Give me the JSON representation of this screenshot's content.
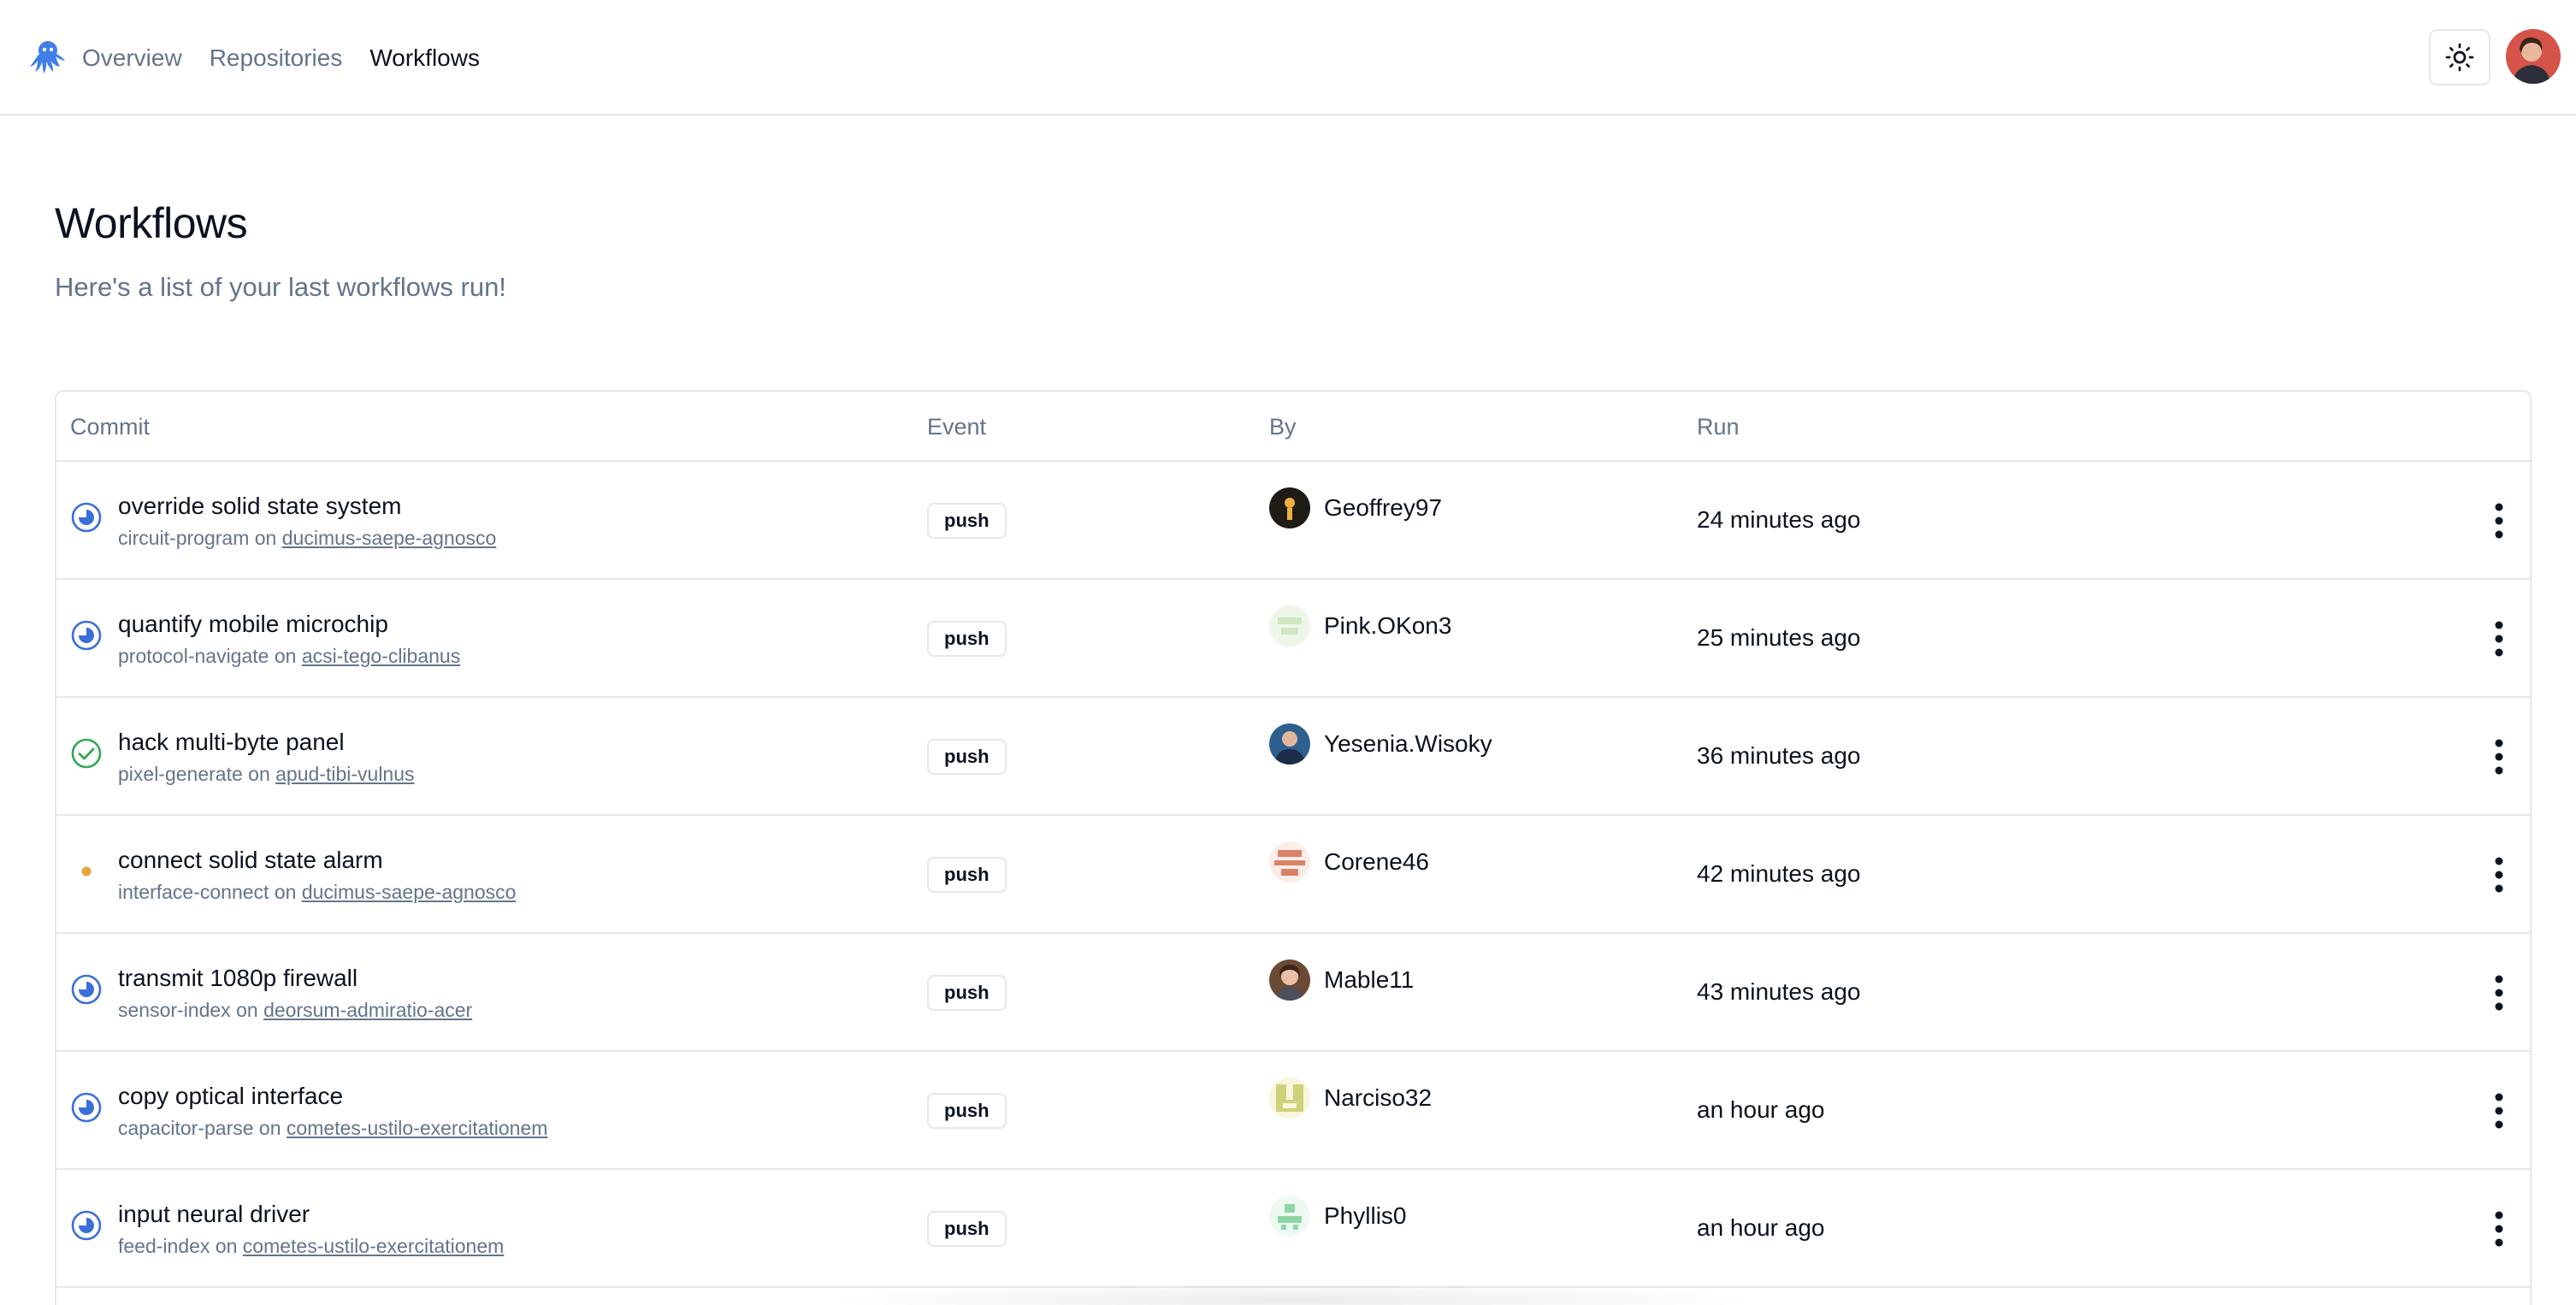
{
  "nav": {
    "items": [
      {
        "label": "Overview",
        "active": false
      },
      {
        "label": "Repositories",
        "active": false
      },
      {
        "label": "Workflows",
        "active": true
      }
    ],
    "logo_icon": "octopus-logo-icon",
    "theme_icon": "sun-icon"
  },
  "header": {
    "title": "Workflows",
    "subtitle": "Here's a list of your last workflows run!"
  },
  "table": {
    "columns": {
      "commit": "Commit",
      "event": "Event",
      "by": "By",
      "run": "Run"
    },
    "rows": [
      {
        "status": "in-progress",
        "title": "override solid state system",
        "branch": "circuit-program",
        "on": "on",
        "repo": "ducimus-saepe-agnosco",
        "event": "push",
        "user": "Geoffrey97",
        "avatar_color": "#1f1b16",
        "run": "24 minutes ago"
      },
      {
        "status": "in-progress",
        "title": "quantify mobile microchip",
        "branch": "protocol-navigate",
        "on": "on",
        "repo": "acsi-tego-clibanus",
        "event": "push",
        "user": "Pink.OKon3",
        "avatar_color": "#cfe7c0",
        "run": "25 minutes ago"
      },
      {
        "status": "success",
        "title": "hack multi-byte panel",
        "branch": "pixel-generate",
        "on": "on",
        "repo": "apud-tibi-vulnus",
        "event": "push",
        "user": "Yesenia.Wisoky",
        "avatar_color": "#2f5f8f",
        "run": "36 minutes ago"
      },
      {
        "status": "queued",
        "title": "connect solid state alarm",
        "branch": "interface-connect",
        "on": "on",
        "repo": "ducimus-saepe-agnosco",
        "event": "push",
        "user": "Corene46",
        "avatar_color": "#d9826a",
        "run": "42 minutes ago"
      },
      {
        "status": "in-progress",
        "title": "transmit 1080p firewall",
        "branch": "sensor-index",
        "on": "on",
        "repo": "deorsum-admiratio-acer",
        "event": "push",
        "user": "Mable11",
        "avatar_color": "#6b4a35",
        "run": "43 minutes ago"
      },
      {
        "status": "in-progress",
        "title": "copy optical interface",
        "branch": "capacitor-parse",
        "on": "on",
        "repo": "cometes-ustilo-exercitationem",
        "event": "push",
        "user": "Narciso32",
        "avatar_color": "#cfd27a",
        "run": "an hour ago"
      },
      {
        "status": "in-progress",
        "title": "input neural driver",
        "branch": "feed-index",
        "on": "on",
        "repo": "cometes-ustilo-exercitationem",
        "event": "push",
        "user": "Phyllis0",
        "avatar_color": "#8fd6a6",
        "run": "an hour ago"
      }
    ]
  },
  "colors": {
    "in_progress": "#3b6fd8",
    "success": "#34a853",
    "queued": "#e8a33c",
    "border": "#e5e7eb",
    "muted_text": "#64748b"
  }
}
